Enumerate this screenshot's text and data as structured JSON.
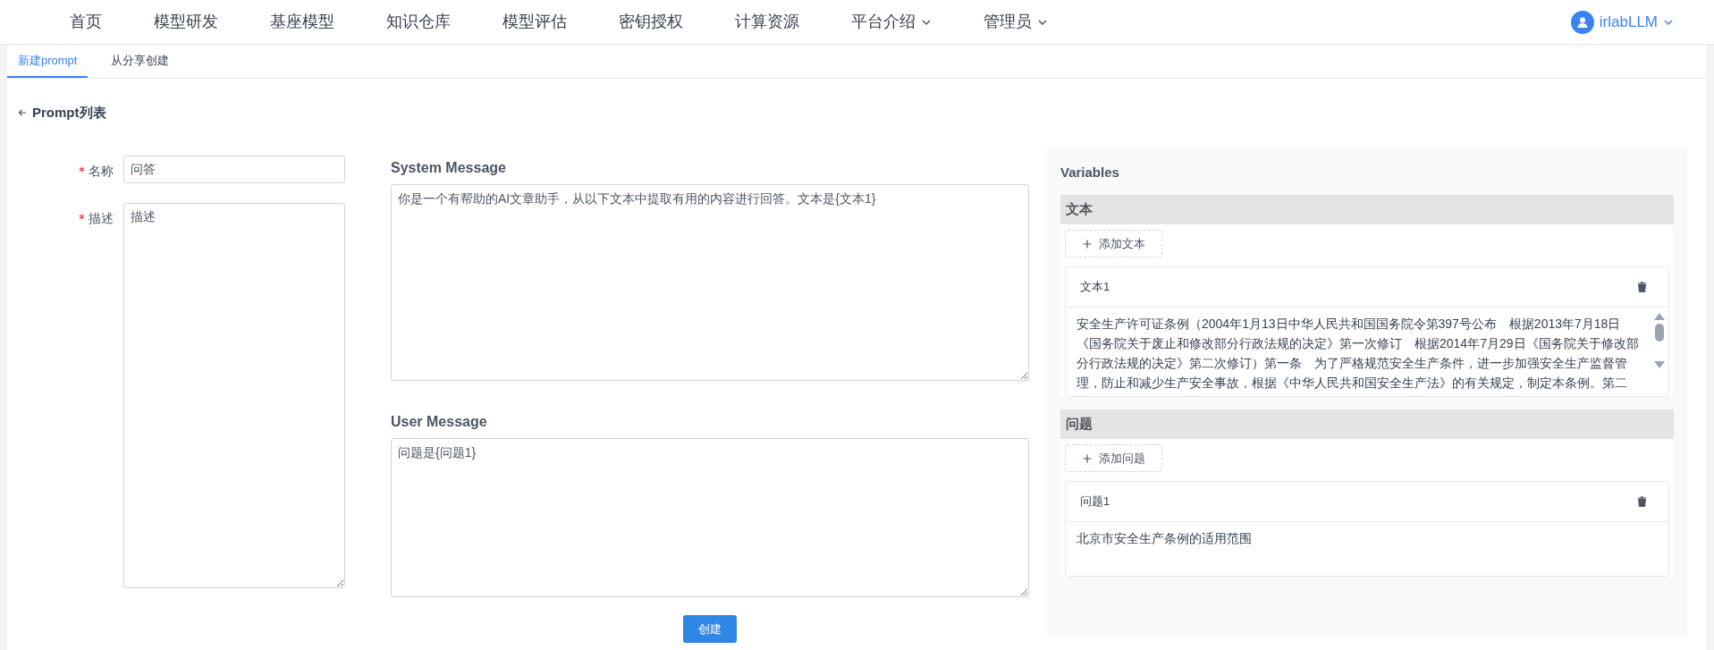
{
  "nav": {
    "items": [
      {
        "label": "首页",
        "dropdown": false
      },
      {
        "label": "模型研发",
        "dropdown": false
      },
      {
        "label": "基座模型",
        "dropdown": false
      },
      {
        "label": "知识仓库",
        "dropdown": false
      },
      {
        "label": "模型评估",
        "dropdown": false
      },
      {
        "label": "密钥授权",
        "dropdown": false
      },
      {
        "label": "计算资源",
        "dropdown": false
      },
      {
        "label": "平台介绍",
        "dropdown": true
      },
      {
        "label": "管理员",
        "dropdown": true
      }
    ],
    "user": {
      "name": "irlabLLM"
    }
  },
  "tabs": [
    {
      "label": "新建prompt",
      "selected": true
    },
    {
      "label": "从分享创建",
      "selected": false
    }
  ],
  "back_link": "Prompt列表",
  "form": {
    "fields": [
      {
        "label": "名称",
        "required": true,
        "kind": "input",
        "value": "问答"
      },
      {
        "label": "描述",
        "required": true,
        "kind": "textarea",
        "value": "描述"
      }
    ]
  },
  "messages": [
    {
      "title": "System Message",
      "value": "你是一个有帮助的AI文章助手，从以下文本中提取有用的内容进行回答。文本是{文本1}"
    },
    {
      "title": "User Message",
      "value": "问题是{问题1}"
    }
  ],
  "create_button": "创建",
  "variables": {
    "title": "Variables",
    "groups": [
      {
        "title": "文本",
        "add_button": "添加文本",
        "items": [
          {
            "name": "文本1",
            "value": "安全生产许可证条例（2004年1月13日中华人民共和国国务院令第397号公布　根据2013年7月18日《国务院关于废止和修改部分行政法规的决定》第一次修订　根据2014年7月29日《国务院关于修改部分行政法规的决定》第二次修订）第一条　为了严格规范安全生产条件，进一步加强安全生产监督管理，防止和减少生产安全事故，根据《中华人民共和国安全生产法》的有关规定，制定本条例。第二",
            "scrollable": true
          }
        ]
      },
      {
        "title": "问题",
        "add_button": "添加问题",
        "items": [
          {
            "name": "问题1",
            "value": "北京市安全生产条例的适用范围",
            "scrollable": false
          }
        ]
      }
    ]
  }
}
